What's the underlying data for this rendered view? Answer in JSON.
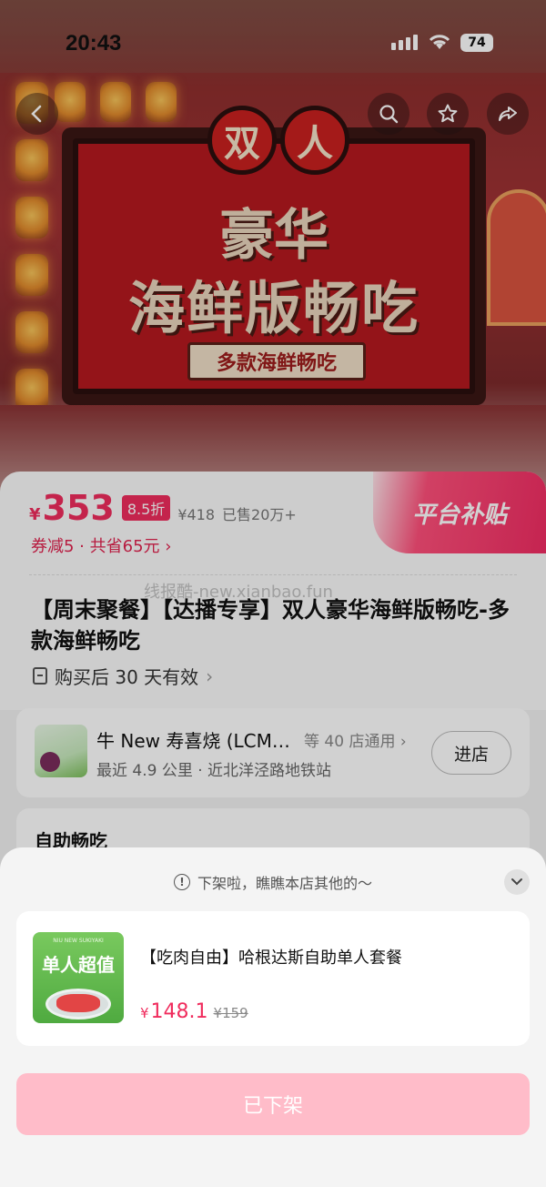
{
  "status_bar": {
    "time": "20:43",
    "battery": "74"
  },
  "hero": {
    "badge_left": "双",
    "badge_right": "人",
    "line1": "豪华",
    "line2": "海鲜版畅吃",
    "tag": "多款海鲜畅吃"
  },
  "price": {
    "currency": "¥",
    "value": "353",
    "discount": "8.5折",
    "original": "¥418",
    "sold": "已售20万+",
    "coupon": "券减5 · 共省65元",
    "subsidy": "平台补贴"
  },
  "watermark": "线报酷-new.xianbao.fun",
  "title": "【周末聚餐】【达播专享】双人豪华海鲜版畅吃-多款海鲜畅吃",
  "validity": "购买后 30 天有效",
  "store": {
    "name": "牛 New 寿喜烧 (LCM…",
    "count": "等 40 店通用",
    "distance": "最近 4.9 公里 · 近北洋泾路地铁站",
    "enter_label": "进店"
  },
  "buffet_section": {
    "title": "自助畅吃"
  },
  "sheet": {
    "message": "下架啦，瞧瞧本店其他的～",
    "product": {
      "image_label": "单人超值",
      "image_brand": "NIU NEW SUKIYAKI",
      "name": "【吃肉自由】哈根达斯自助单人套餐",
      "currency": "¥",
      "price": "148.1",
      "original": "¥159"
    },
    "delisted_label": "已下架"
  },
  "colors": {
    "accent": "#f02c5d",
    "delisted_button": "#ffbcc9",
    "hero_red": "#b5191f"
  }
}
